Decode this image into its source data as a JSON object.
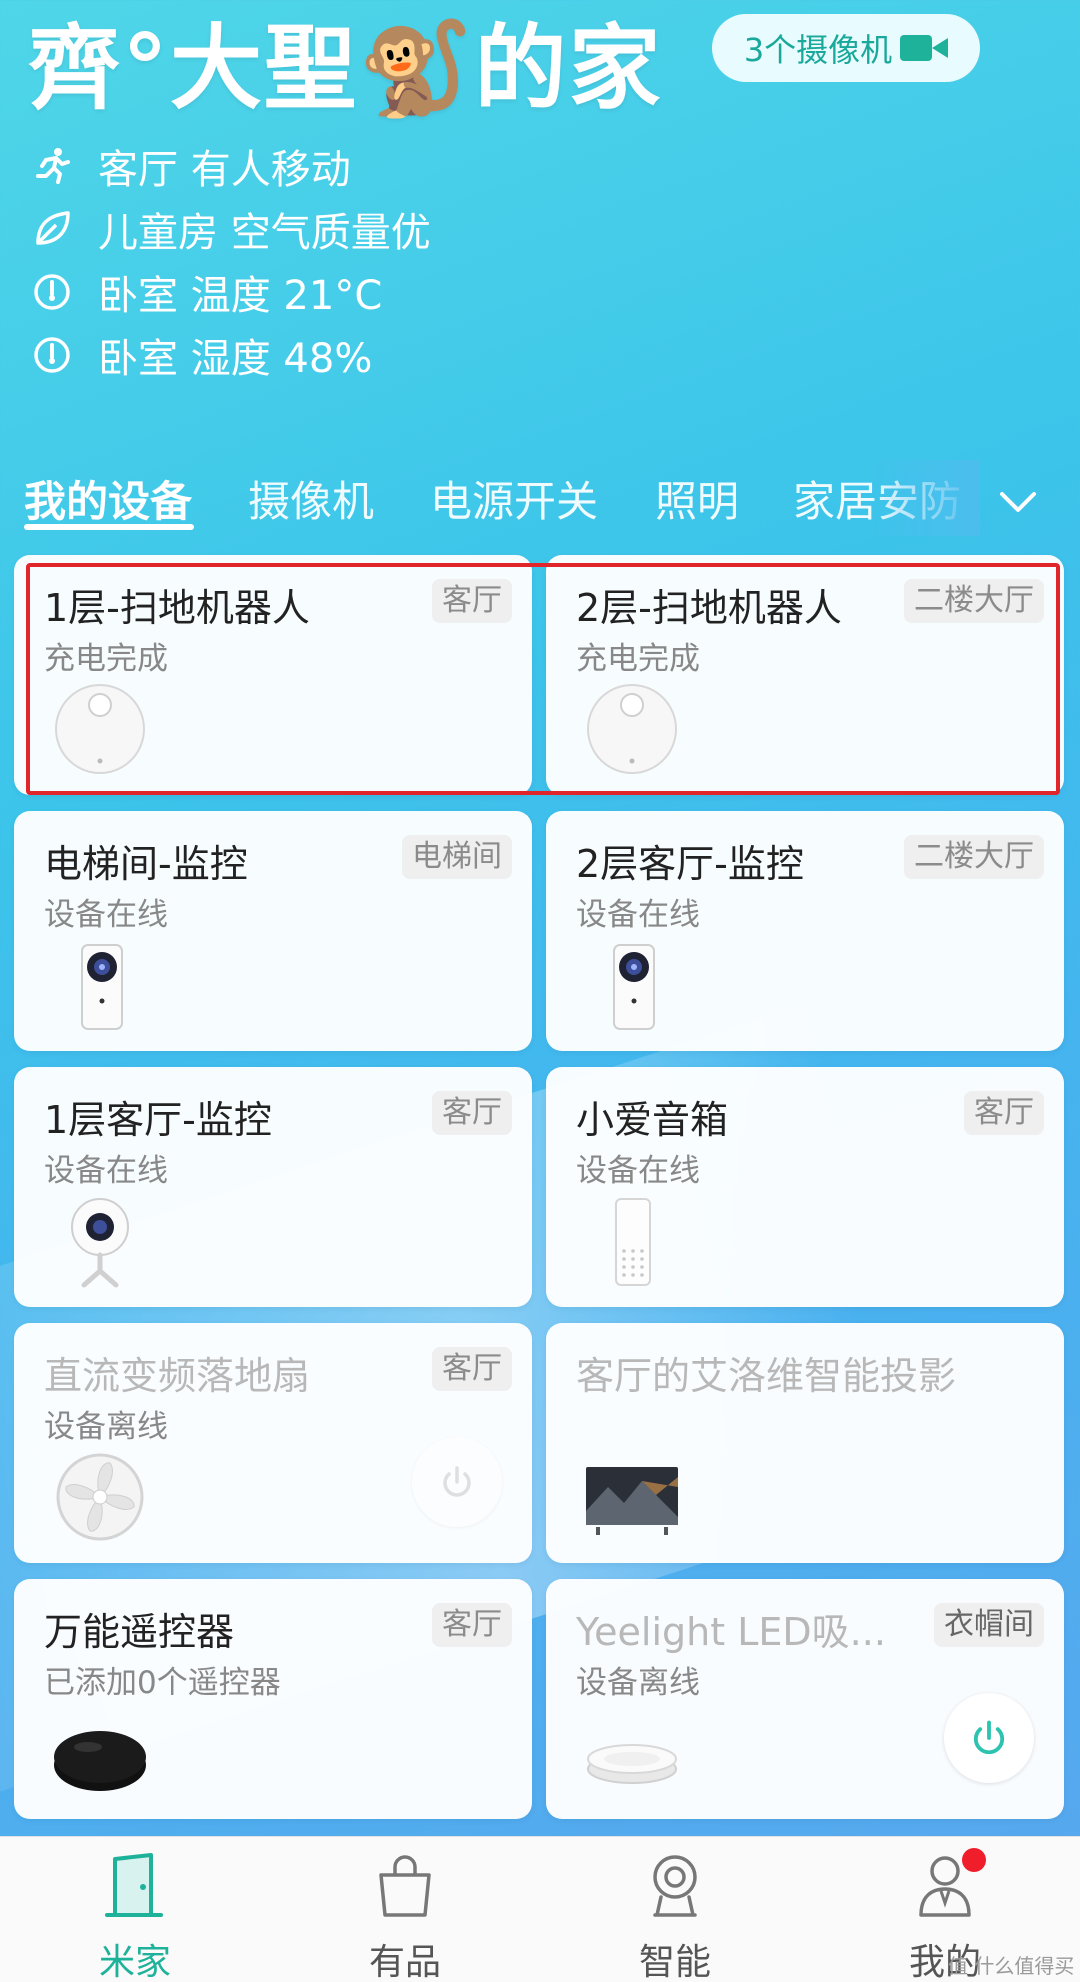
{
  "header": {
    "home_title": "齊°大聖🐒的家",
    "camera_pill_label": "3个摄像机",
    "status": [
      {
        "icon": "running-person-icon",
        "text": "客厅 有人移动"
      },
      {
        "icon": "leaf-icon",
        "text": "儿童房 空气质量优"
      },
      {
        "icon": "gauge-icon",
        "text": "卧室 温度 21°C"
      },
      {
        "icon": "gauge-icon",
        "text": "卧室 湿度 48%"
      }
    ]
  },
  "tabs": [
    "我的设备",
    "摄像机",
    "电源开关",
    "照明",
    "家居安防"
  ],
  "devices": [
    {
      "name": "1层-扫地机器人",
      "status": "充电完成",
      "room": "客厅",
      "icon": "robot-vacuum-icon",
      "offline": false
    },
    {
      "name": "2层-扫地机器人",
      "status": "充电完成",
      "room": "二楼大厅",
      "icon": "robot-vacuum-icon",
      "offline": false
    },
    {
      "name": "电梯间-监控",
      "status": "设备在线",
      "room": "电梯间",
      "icon": "security-camera-icon",
      "offline": false
    },
    {
      "name": "2层客厅-监控",
      "status": "设备在线",
      "room": "二楼大厅",
      "icon": "security-camera-icon",
      "offline": false
    },
    {
      "name": "1层客厅-监控",
      "status": "设备在线",
      "room": "客厅",
      "icon": "dome-camera-icon",
      "offline": false
    },
    {
      "name": "小爱音箱",
      "status": "设备在线",
      "room": "客厅",
      "icon": "smart-speaker-icon",
      "offline": false
    },
    {
      "name": "直流变频落地扇",
      "status": "设备离线",
      "room": "客厅",
      "icon": "fan-icon",
      "offline": true
    },
    {
      "name": "客厅的艾洛维智能投影",
      "status": "",
      "room": "",
      "icon": "tv-icon",
      "offline": true
    },
    {
      "name": "万能遥控器",
      "status": "已添加0个遥控器",
      "room": "客厅",
      "icon": "ir-remote-hub-icon",
      "offline": false
    },
    {
      "name": "Yeelight LED吸...",
      "status": "设备离线",
      "room": "衣帽间",
      "icon": "ceiling-light-icon",
      "offline": true
    }
  ],
  "bottom_nav": [
    {
      "label": "米家",
      "icon": "home-door-icon",
      "active": true
    },
    {
      "label": "有品",
      "icon": "shopping-bag-icon",
      "active": false
    },
    {
      "label": "智能",
      "icon": "smart-robot-icon",
      "active": false
    },
    {
      "label": "我的",
      "icon": "profile-icon",
      "active": false
    }
  ],
  "watermark": "值 什么值得买",
  "colors": {
    "accent": "#1fb29a",
    "highlight": "#e0262b",
    "badge": "#f01e2a"
  }
}
